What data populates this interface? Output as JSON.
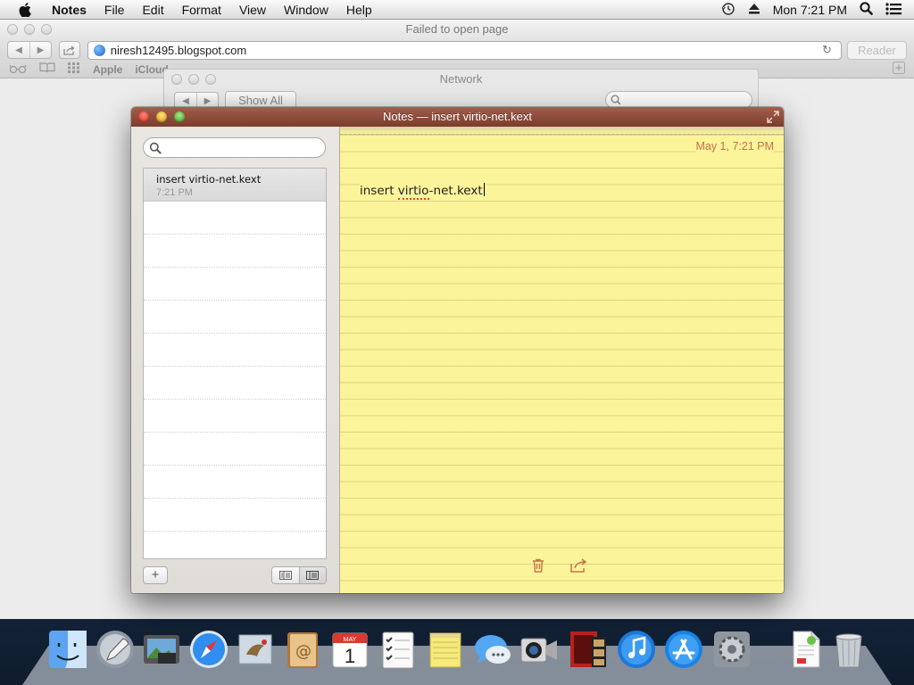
{
  "menubar": {
    "app_name": "Notes",
    "menus": [
      "File",
      "Edit",
      "Format",
      "View",
      "Window",
      "Help"
    ],
    "clock": "Mon 7:21 PM"
  },
  "safari": {
    "title": "Failed to open page",
    "url": "niresh12495.blogspot.com",
    "reader_label": "Reader",
    "bookmarks": [
      "Apple",
      "iCloud"
    ]
  },
  "network": {
    "title": "Network",
    "show_all": "Show All"
  },
  "notes": {
    "window_title": "Notes — insert virtio-net.kext",
    "search_placeholder": "",
    "list": [
      {
        "title": "insert virtio-net.kext",
        "time": "7:21 PM"
      }
    ],
    "note": {
      "date": "May 1, 7:21 PM",
      "text_before": "insert ",
      "text_squiggle": "virtio",
      "text_after": "-net.kext"
    },
    "add_label": "+"
  },
  "dock": {
    "apps": [
      "Finder",
      "Launchpad",
      "Image Capture",
      "Safari",
      "Mail",
      "Contacts",
      "Calendar",
      "Reminders",
      "Notes",
      "Messages",
      "FaceTime",
      "Photo Booth",
      "iTunes",
      "App Store",
      "System Preferences",
      "Document",
      "Trash"
    ],
    "calendar_month": "MAY",
    "calendar_day": "1"
  }
}
